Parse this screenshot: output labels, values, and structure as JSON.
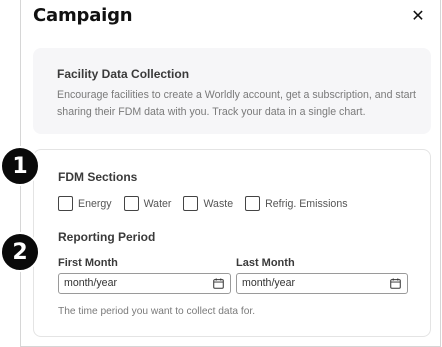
{
  "modal": {
    "title": "Campaign",
    "close_glyph": "✕"
  },
  "info": {
    "title": "Facility Data Collection",
    "text": "Encourage facilities to create a Worldly account, get a subscription, and start sharing their FDM data with you. Track your data in a single chart."
  },
  "fdm_sections": {
    "title": "FDM Sections",
    "options": [
      {
        "label": "Energy",
        "checked": false
      },
      {
        "label": "Water",
        "checked": false
      },
      {
        "label": "Waste",
        "checked": false
      },
      {
        "label": "Refrig. Emissions",
        "checked": false
      }
    ]
  },
  "reporting_period": {
    "title": "Reporting Period",
    "first_month": {
      "label": "First Month",
      "placeholder": "month/year",
      "icon": "calendar-icon"
    },
    "last_month": {
      "label": "Last Month",
      "placeholder": "month/year",
      "icon": "calendar-icon"
    },
    "helper": "The time period you want to collect data for."
  },
  "badges": [
    "1",
    "2"
  ],
  "colors": {
    "badge_bg": "#0a0a0a",
    "info_bg": "#f6f6f8"
  }
}
